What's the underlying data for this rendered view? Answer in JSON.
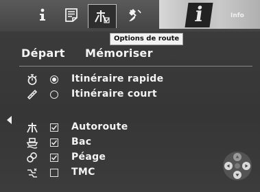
{
  "tabs": [
    {
      "id": "info",
      "icon": "info-icon"
    },
    {
      "id": "doc",
      "icon": "document-icon"
    },
    {
      "id": "route",
      "icon": "route-options-icon",
      "active": true
    },
    {
      "id": "sat",
      "icon": "satellite-icon"
    }
  ],
  "thumb": {
    "text": "Info"
  },
  "tooltip": "Options de route",
  "menu": {
    "depart": "Départ",
    "memoriser": "Mémoriser"
  },
  "options": [
    {
      "label": "Itinéraire rapide",
      "control": "radio",
      "checked": true,
      "icon": "stopwatch-icon"
    },
    {
      "label": "Itinéraire court",
      "control": "radio",
      "checked": false,
      "icon": "ruler-icon"
    },
    {
      "label": "Autoroute",
      "control": "checkbox",
      "checked": true,
      "icon": "highway-icon"
    },
    {
      "label": "Bac",
      "control": "checkbox",
      "checked": true,
      "icon": "ferry-icon"
    },
    {
      "label": "Péage",
      "control": "checkbox",
      "checked": true,
      "icon": "toll-icon"
    },
    {
      "label": "TMC",
      "control": "checkbox",
      "checked": false,
      "icon": "tmc-icon"
    }
  ]
}
